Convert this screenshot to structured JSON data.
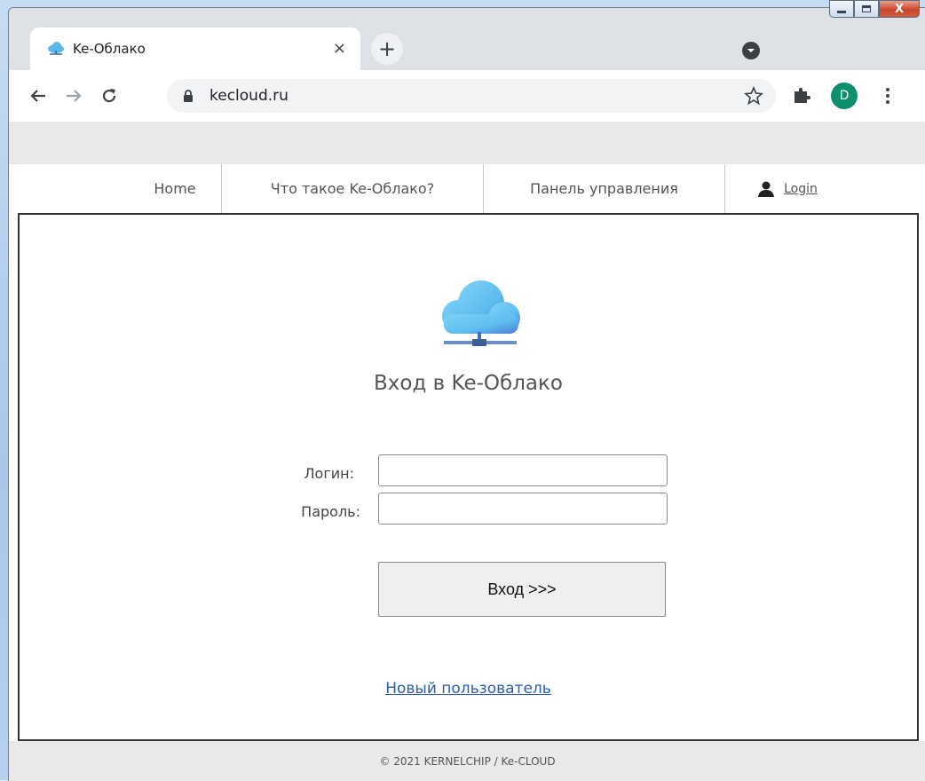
{
  "browser": {
    "tab_title": "Ke-Облако",
    "new_tab_symbol": "+",
    "close_tab_symbol": "×",
    "url": "kecloud.ru",
    "avatar_letter": "D",
    "icons": [
      "cloud-favicon-icon",
      "back-arrow-icon",
      "forward-arrow-icon",
      "reload-icon",
      "lock-icon",
      "star-icon",
      "puzzle-extension-icon",
      "kebab-menu-icon",
      "tab-search-icon"
    ]
  },
  "window_controls": {
    "close_symbol": "X"
  },
  "nav": {
    "items": [
      {
        "label": "Home"
      },
      {
        "label": "Что такое Ke-Облако?"
      },
      {
        "label": "Панель управления"
      }
    ],
    "login_label": "Login"
  },
  "login_form": {
    "title": "Вход в Ke-Облако",
    "login_label": "Логин:",
    "password_label": "Пароль:",
    "login_value": "",
    "password_value": "",
    "submit_label": "Вход >>>",
    "new_user_link": "Новый пользователь"
  },
  "footer": {
    "text": "© 2021 KERNELCHIP / Ke-CLOUD"
  },
  "colors": {
    "link": "#2a5db0",
    "avatar": "#0b8f6c",
    "card_border": "#333333"
  }
}
